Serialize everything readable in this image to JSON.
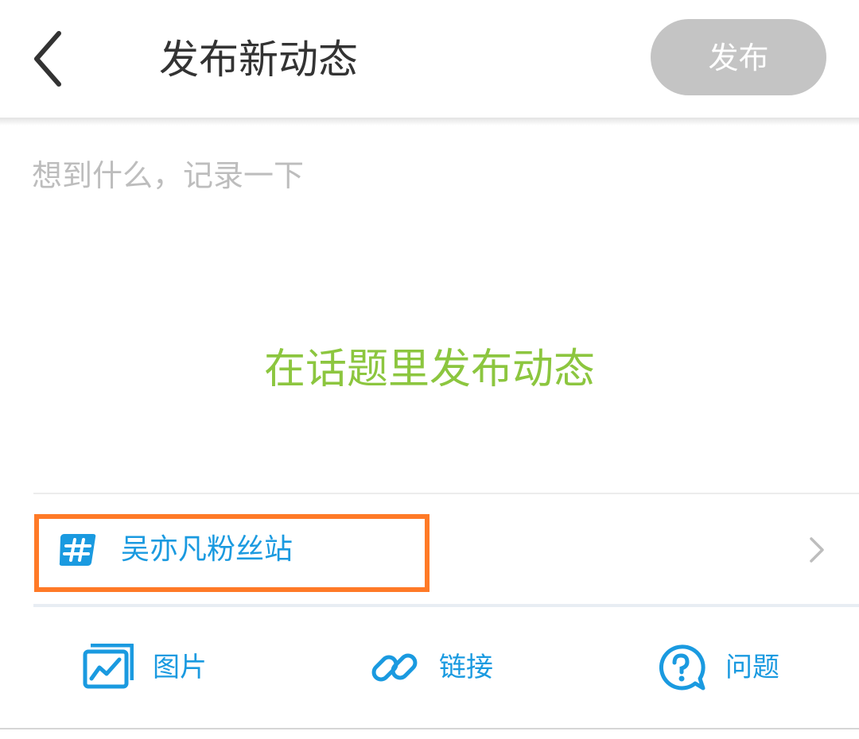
{
  "header": {
    "title": "发布新动态",
    "publish_label": "发布"
  },
  "composer": {
    "placeholder": "想到什么，记录一下",
    "value": ""
  },
  "topic_hint": "在话题里发布动态",
  "topic": {
    "name": "吴亦凡粉丝站"
  },
  "toolbar": {
    "image_label": "图片",
    "link_label": "链接",
    "question_label": "问题"
  },
  "colors": {
    "accent_blue": "#1a9ae0",
    "hint_green": "#8cc63f",
    "highlight_orange": "#ff7a27",
    "publish_disabled": "#c4c4c4"
  }
}
